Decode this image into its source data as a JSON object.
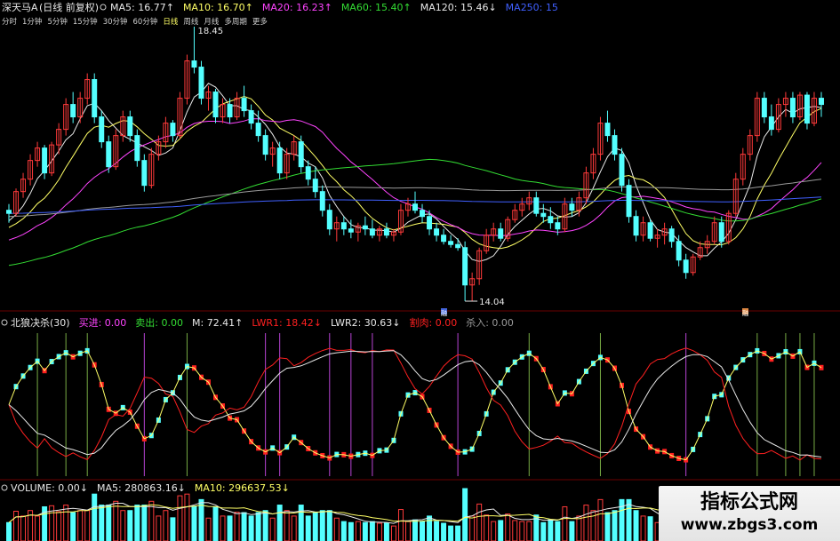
{
  "colors": {
    "up": "#ff3a3a",
    "down": "#54ffff",
    "white": "#e8e8e8",
    "yellow": "#ffff66",
    "magenta": "#ff44ff",
    "green": "#33dd33",
    "blue": "#4060ff",
    "purple": "#b844d4",
    "red": "#ff2020",
    "gray": "#9a9a9a",
    "olive": "#77aa44"
  },
  "stock": {
    "name": "深天马A",
    "mode": "(日线 前复权)"
  },
  "periods": [
    "分时",
    "1分钟",
    "5分钟",
    "15分钟",
    "30分钟",
    "60分钟",
    "日线",
    "周线",
    "月线",
    "多周期",
    "更多"
  ],
  "active_period": 6,
  "ma_legend": [
    {
      "label": "MA5: 16.77",
      "arrow": "↑",
      "color": "#e8e8e8"
    },
    {
      "label": "MA10: 16.70",
      "arrow": "↑",
      "color": "#ffff66"
    },
    {
      "label": "MA20: 16.23",
      "arrow": "↑",
      "color": "#ff44ff"
    },
    {
      "label": "MA60: 15.40",
      "arrow": "↑",
      "color": "#33dd33"
    },
    {
      "label": "MA120: 15.46",
      "arrow": "↓",
      "color": "#e8e8e8"
    },
    {
      "label": "MA250: 15",
      "arrow": "",
      "color": "#4060ff"
    }
  ],
  "indicator": {
    "name": "北狼决杀(30)",
    "fields": [
      {
        "label": "买进: 0.00",
        "color": "#ff44ff"
      },
      {
        "label": "卖出: 0.00",
        "color": "#33dd33"
      },
      {
        "label": "M: 72.41↑",
        "color": "#e8e8e8"
      },
      {
        "label": "LWR1: 18.42↓",
        "color": "#ff2020"
      },
      {
        "label": "LWR2: 30.63↓",
        "color": "#e8e8e8"
      },
      {
        "label": "割肉: 0.00",
        "color": "#ff2020"
      },
      {
        "label": "杀入: 0.00",
        "color": "#9a9a9a"
      }
    ]
  },
  "volume": {
    "fields": [
      {
        "label": "VOLUME: 0.00↓",
        "color": "#e8e8e8"
      },
      {
        "label": "MA5: 280863.16↓",
        "color": "#e8e8e8"
      },
      {
        "label": "MA10: 296637.53↓",
        "color": "#ffff66"
      }
    ]
  },
  "annotations": {
    "high_label": "18.45",
    "low_label": "14.04",
    "marker_1": "融",
    "marker_2": "融"
  },
  "watermark": {
    "cn": "指标公式网",
    "url": "www.zbgs3.com"
  },
  "chart_data": {
    "type": "candlestick",
    "title": "深天马A (日线 前复权)",
    "price_high": 18.45,
    "price_low": 14.04,
    "candles": [
      [
        15.5,
        15.6,
        15.3,
        15.45
      ],
      [
        15.45,
        15.85,
        15.4,
        15.8
      ],
      [
        15.8,
        16.1,
        15.7,
        16.0
      ],
      [
        16.0,
        16.4,
        15.9,
        16.3
      ],
      [
        16.3,
        16.6,
        16.2,
        16.5
      ],
      [
        16.5,
        16.55,
        16.0,
        16.1
      ],
      [
        16.1,
        16.6,
        16.05,
        16.55
      ],
      [
        16.55,
        16.9,
        16.4,
        16.8
      ],
      [
        16.8,
        17.3,
        16.7,
        17.2
      ],
      [
        17.2,
        17.4,
        16.9,
        17.0
      ],
      [
        17.0,
        17.4,
        16.9,
        17.3
      ],
      [
        17.3,
        17.7,
        17.2,
        17.6
      ],
      [
        17.6,
        17.7,
        16.9,
        17.0
      ],
      [
        17.0,
        17.1,
        16.5,
        16.6
      ],
      [
        16.6,
        16.7,
        16.1,
        16.2
      ],
      [
        16.2,
        16.8,
        16.15,
        16.7
      ],
      [
        16.7,
        17.1,
        16.6,
        17.0
      ],
      [
        17.0,
        17.1,
        16.6,
        16.7
      ],
      [
        16.7,
        16.8,
        16.2,
        16.3
      ],
      [
        16.3,
        16.4,
        15.8,
        15.9
      ],
      [
        15.9,
        16.5,
        15.85,
        16.4
      ],
      [
        16.4,
        16.7,
        16.3,
        16.6
      ],
      [
        16.6,
        17.0,
        16.5,
        16.9
      ],
      [
        16.9,
        16.95,
        16.6,
        16.7
      ],
      [
        16.7,
        17.4,
        16.65,
        17.3
      ],
      [
        17.3,
        18.0,
        17.2,
        17.9
      ],
      [
        17.9,
        18.45,
        17.7,
        17.8
      ],
      [
        17.8,
        17.9,
        17.2,
        17.3
      ],
      [
        17.3,
        17.5,
        17.1,
        17.4
      ],
      [
        17.4,
        17.45,
        16.9,
        17.0
      ],
      [
        17.0,
        17.3,
        16.9,
        17.2
      ],
      [
        17.2,
        17.3,
        16.9,
        17.0
      ],
      [
        17.0,
        17.4,
        16.95,
        17.3
      ],
      [
        17.3,
        17.5,
        17.0,
        17.1
      ],
      [
        17.1,
        17.2,
        16.8,
        16.9
      ],
      [
        16.9,
        17.1,
        16.6,
        16.7
      ],
      [
        16.7,
        16.8,
        16.3,
        16.4
      ],
      [
        16.4,
        16.6,
        16.2,
        16.5
      ],
      [
        16.5,
        16.6,
        16.0,
        16.1
      ],
      [
        16.1,
        16.5,
        16.0,
        16.4
      ],
      [
        16.4,
        16.7,
        16.3,
        16.6
      ],
      [
        16.6,
        16.7,
        16.1,
        16.2
      ],
      [
        16.2,
        16.3,
        15.9,
        16.0
      ],
      [
        16.0,
        16.2,
        15.7,
        15.8
      ],
      [
        15.8,
        15.9,
        15.4,
        15.5
      ],
      [
        15.5,
        15.6,
        15.1,
        15.2
      ],
      [
        15.2,
        15.4,
        15.0,
        15.3
      ],
      [
        15.3,
        15.4,
        15.1,
        15.2
      ],
      [
        15.2,
        15.35,
        15.05,
        15.15
      ],
      [
        15.15,
        15.3,
        15.0,
        15.25
      ],
      [
        15.25,
        15.4,
        15.1,
        15.2
      ],
      [
        15.2,
        15.35,
        15.05,
        15.1
      ],
      [
        15.1,
        15.25,
        15.0,
        15.2
      ],
      [
        15.2,
        15.3,
        15.05,
        15.1
      ],
      [
        15.1,
        15.2,
        15.0,
        15.15
      ],
      [
        15.15,
        15.6,
        15.1,
        15.5
      ],
      [
        15.5,
        15.7,
        15.4,
        15.6
      ],
      [
        15.6,
        15.8,
        15.45,
        15.5
      ],
      [
        15.5,
        15.6,
        15.3,
        15.4
      ],
      [
        15.4,
        15.5,
        15.1,
        15.2
      ],
      [
        15.2,
        15.3,
        15.0,
        15.1
      ],
      [
        15.1,
        15.2,
        14.95,
        15.0
      ],
      [
        15.0,
        15.1,
        14.9,
        14.95
      ],
      [
        14.95,
        15.05,
        14.85,
        14.9
      ],
      [
        14.9,
        15.0,
        14.04,
        14.3
      ],
      [
        14.3,
        14.5,
        14.04,
        14.4
      ],
      [
        14.4,
        14.9,
        14.3,
        14.85
      ],
      [
        14.85,
        15.2,
        14.8,
        15.1
      ],
      [
        15.1,
        15.3,
        15.0,
        15.2
      ],
      [
        15.2,
        15.3,
        15.0,
        15.05
      ],
      [
        15.05,
        15.4,
        15.0,
        15.35
      ],
      [
        15.35,
        15.6,
        15.3,
        15.5
      ],
      [
        15.5,
        15.7,
        15.4,
        15.6
      ],
      [
        15.6,
        15.8,
        15.5,
        15.7
      ],
      [
        15.7,
        15.8,
        15.4,
        15.45
      ],
      [
        15.45,
        15.6,
        15.3,
        15.4
      ],
      [
        15.4,
        15.55,
        15.2,
        15.3
      ],
      [
        15.3,
        15.4,
        15.1,
        15.2
      ],
      [
        15.2,
        15.7,
        15.15,
        15.6
      ],
      [
        15.6,
        15.7,
        15.4,
        15.5
      ],
      [
        15.5,
        15.8,
        15.4,
        15.7
      ],
      [
        15.7,
        16.2,
        15.6,
        16.1
      ],
      [
        16.1,
        16.5,
        16.0,
        16.4
      ],
      [
        16.4,
        17.0,
        16.3,
        16.9
      ],
      [
        16.9,
        17.1,
        16.6,
        16.7
      ],
      [
        16.7,
        16.8,
        16.3,
        16.4
      ],
      [
        16.4,
        16.5,
        15.8,
        15.9
      ],
      [
        15.9,
        16.0,
        15.3,
        15.4
      ],
      [
        15.4,
        15.5,
        15.0,
        15.1
      ],
      [
        15.1,
        15.4,
        15.0,
        15.3
      ],
      [
        15.3,
        15.35,
        15.0,
        15.05
      ],
      [
        15.05,
        15.2,
        14.9,
        15.1
      ],
      [
        15.1,
        15.3,
        14.95,
        15.2
      ],
      [
        15.2,
        15.25,
        14.9,
        15.0
      ],
      [
        15.0,
        15.1,
        14.6,
        14.7
      ],
      [
        14.7,
        14.8,
        14.4,
        14.5
      ],
      [
        14.5,
        14.8,
        14.45,
        14.75
      ],
      [
        14.75,
        15.0,
        14.7,
        14.9
      ],
      [
        14.9,
        15.1,
        14.8,
        15.0
      ],
      [
        15.0,
        15.4,
        14.95,
        15.3
      ],
      [
        15.3,
        15.4,
        14.9,
        15.0
      ],
      [
        15.0,
        15.5,
        14.95,
        15.45
      ],
      [
        15.45,
        16.1,
        15.4,
        16.0
      ],
      [
        16.0,
        16.5,
        15.9,
        16.4
      ],
      [
        16.4,
        16.8,
        16.3,
        16.7
      ],
      [
        16.7,
        17.4,
        16.6,
        17.3
      ],
      [
        17.3,
        17.4,
        16.9,
        17.0
      ],
      [
        17.0,
        17.2,
        16.7,
        16.8
      ],
      [
        16.8,
        17.3,
        16.75,
        17.2
      ],
      [
        17.2,
        17.4,
        17.0,
        17.3
      ],
      [
        17.3,
        17.4,
        16.9,
        17.0
      ],
      [
        17.0,
        17.4,
        16.95,
        17.35
      ],
      [
        17.35,
        17.4,
        16.8,
        16.9
      ],
      [
        16.9,
        17.4,
        16.85,
        17.3
      ],
      [
        17.3,
        17.4,
        17.0,
        17.2
      ]
    ],
    "ma": {
      "periods": [
        5,
        10,
        20,
        60,
        120,
        250
      ],
      "colors": [
        "#e8e8e8",
        "#ffff66",
        "#ff44ff",
        "#33dd33",
        "#9a9a9a",
        "#4060ff"
      ],
      "seed": [
        15.3,
        15.2,
        15.0,
        14.6,
        15.4,
        15.45
      ]
    },
    "indicator": {
      "series": [
        {
          "name": "M",
          "color": "#e8e8e8"
        },
        {
          "name": "LWR1",
          "color": "#ff2020"
        },
        {
          "name": "LWR2",
          "color": "#e8e8e8"
        }
      ]
    },
    "volume": {
      "ma_colors": [
        "#e8e8e8",
        "#ffff66"
      ]
    }
  }
}
